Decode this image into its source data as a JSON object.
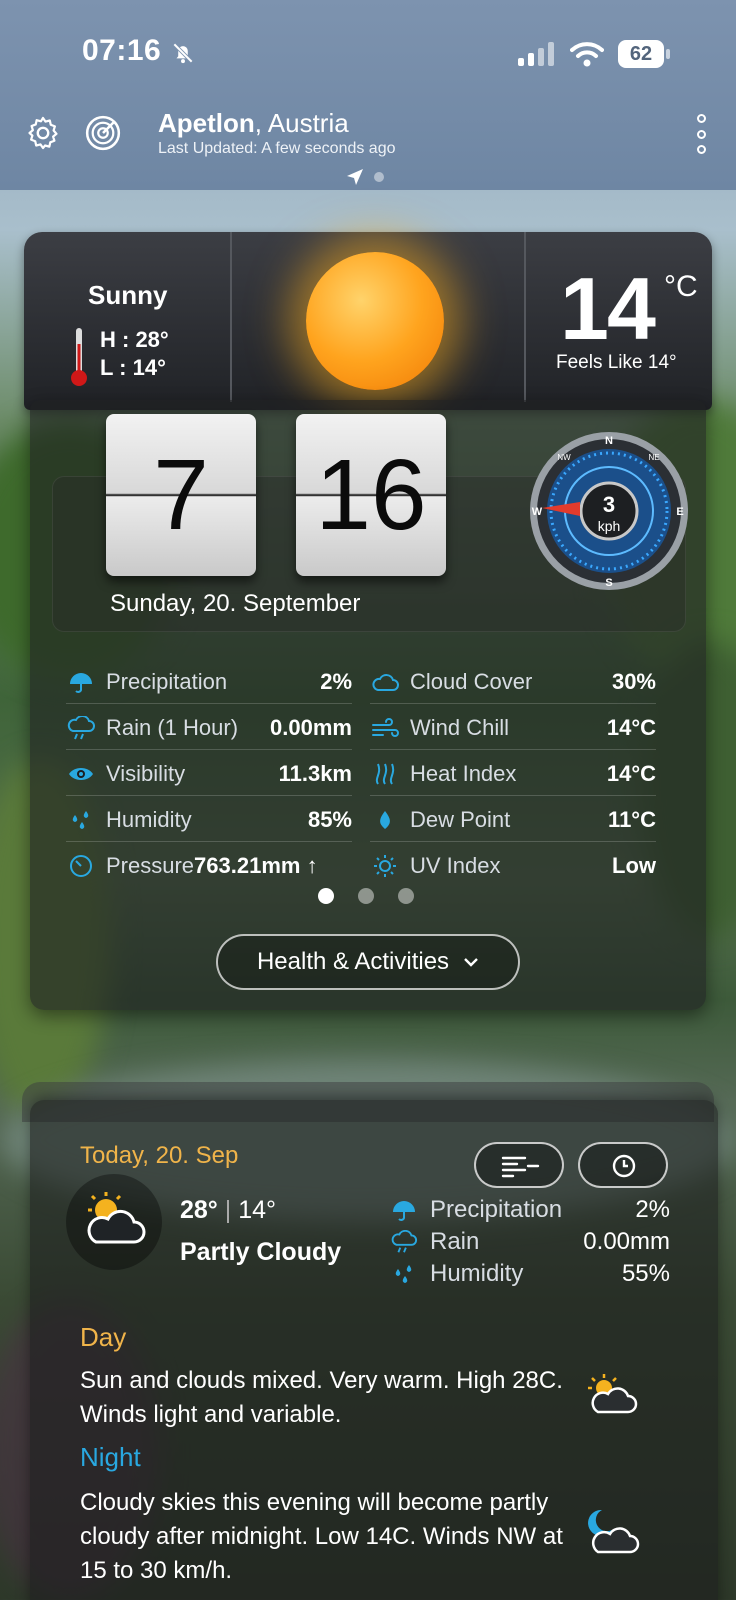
{
  "status_bar": {
    "time": "07:16",
    "battery": "62"
  },
  "header": {
    "city": "Apetlon",
    "country": ", Austria",
    "last_updated": "Last Updated: A few seconds ago"
  },
  "current": {
    "condition": "Sunny",
    "high": "H : 28°",
    "low": "L : 14°",
    "temperature": "14",
    "unit": "°C",
    "feels_like": "Feels Like 14°"
  },
  "clock": {
    "hour": "7",
    "minute": "16",
    "date": "Sunday, 20. September"
  },
  "wind": {
    "speed": "3",
    "unit": "kph",
    "directions": [
      "N",
      "NE",
      "E",
      "S",
      "W",
      "NW"
    ]
  },
  "details": [
    {
      "label": "Precipitation",
      "value": "2%",
      "icon": "umbrella-icon"
    },
    {
      "label": "Cloud Cover",
      "value": "30%",
      "icon": "cloud-icon"
    },
    {
      "label": "Rain (1 Hour)",
      "value": "0.00mm",
      "icon": "rain-cloud-icon"
    },
    {
      "label": "Wind Chill",
      "value": "14°C",
      "icon": "wind-icon"
    },
    {
      "label": "Visibility",
      "value": "11.3km",
      "icon": "eye-icon"
    },
    {
      "label": "Heat Index",
      "value": "14°C",
      "icon": "heat-icon"
    },
    {
      "label": "Humidity",
      "value": "85%",
      "icon": "droplets-icon"
    },
    {
      "label": "Dew Point",
      "value": "11°C",
      "icon": "drop-icon"
    },
    {
      "label": "Pressure",
      "value": "763.21mm ↑",
      "icon": "gauge-icon"
    },
    {
      "label": "UV Index",
      "value": "Low",
      "icon": "sun-small-icon"
    }
  ],
  "health_button": "Health & Activities",
  "forecast": {
    "date_label": "Today, 20. Sep",
    "high": "28°",
    "low": "14°",
    "condition": "Partly Cloudy",
    "mini": [
      {
        "label": "Precipitation",
        "value": "2%"
      },
      {
        "label": "Rain",
        "value": "0.00mm"
      },
      {
        "label": "Humidity",
        "value": "55%"
      }
    ],
    "day_heading": "Day",
    "day_text": "Sun and clouds mixed. Very warm. High 28C. Winds light and variable.",
    "night_heading": "Night",
    "night_text": "Cloudy skies this evening will become partly cloudy after midnight. Low 14C. Winds NW at 15 to 30 km/h."
  },
  "colors": {
    "accent_blue": "#29a8e0",
    "accent_orange": "#f0b44a"
  }
}
